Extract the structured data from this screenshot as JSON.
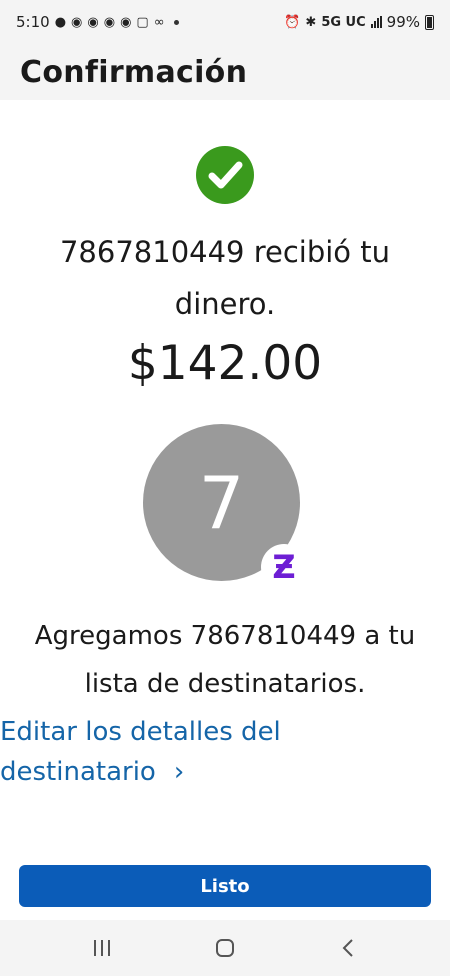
{
  "status_bar": {
    "time": "5:10",
    "network": "5G UC",
    "battery": "99%"
  },
  "header": {
    "title": "Confirmación"
  },
  "confirmation": {
    "received_line1": "7867810449 recibió tu",
    "received_line2": "dinero.",
    "amount": "$142.00"
  },
  "recipient": {
    "avatar_initial": "7",
    "badge_glyph": "Ƶ",
    "added_line1": "Agregamos 7867810449 a tu",
    "added_line2": "lista de destinatarios."
  },
  "edit_link": {
    "line1": "Editar los detalles del",
    "line2": "destinatario",
    "chevron": "›"
  },
  "actions": {
    "done_label": "Listo"
  },
  "colors": {
    "check_green": "#3a9a1d",
    "primary_blue": "#0b5cb8",
    "link_blue": "#1565a8",
    "zelle_purple": "#6d1ed4",
    "avatar_gray": "#9a9a9a"
  }
}
